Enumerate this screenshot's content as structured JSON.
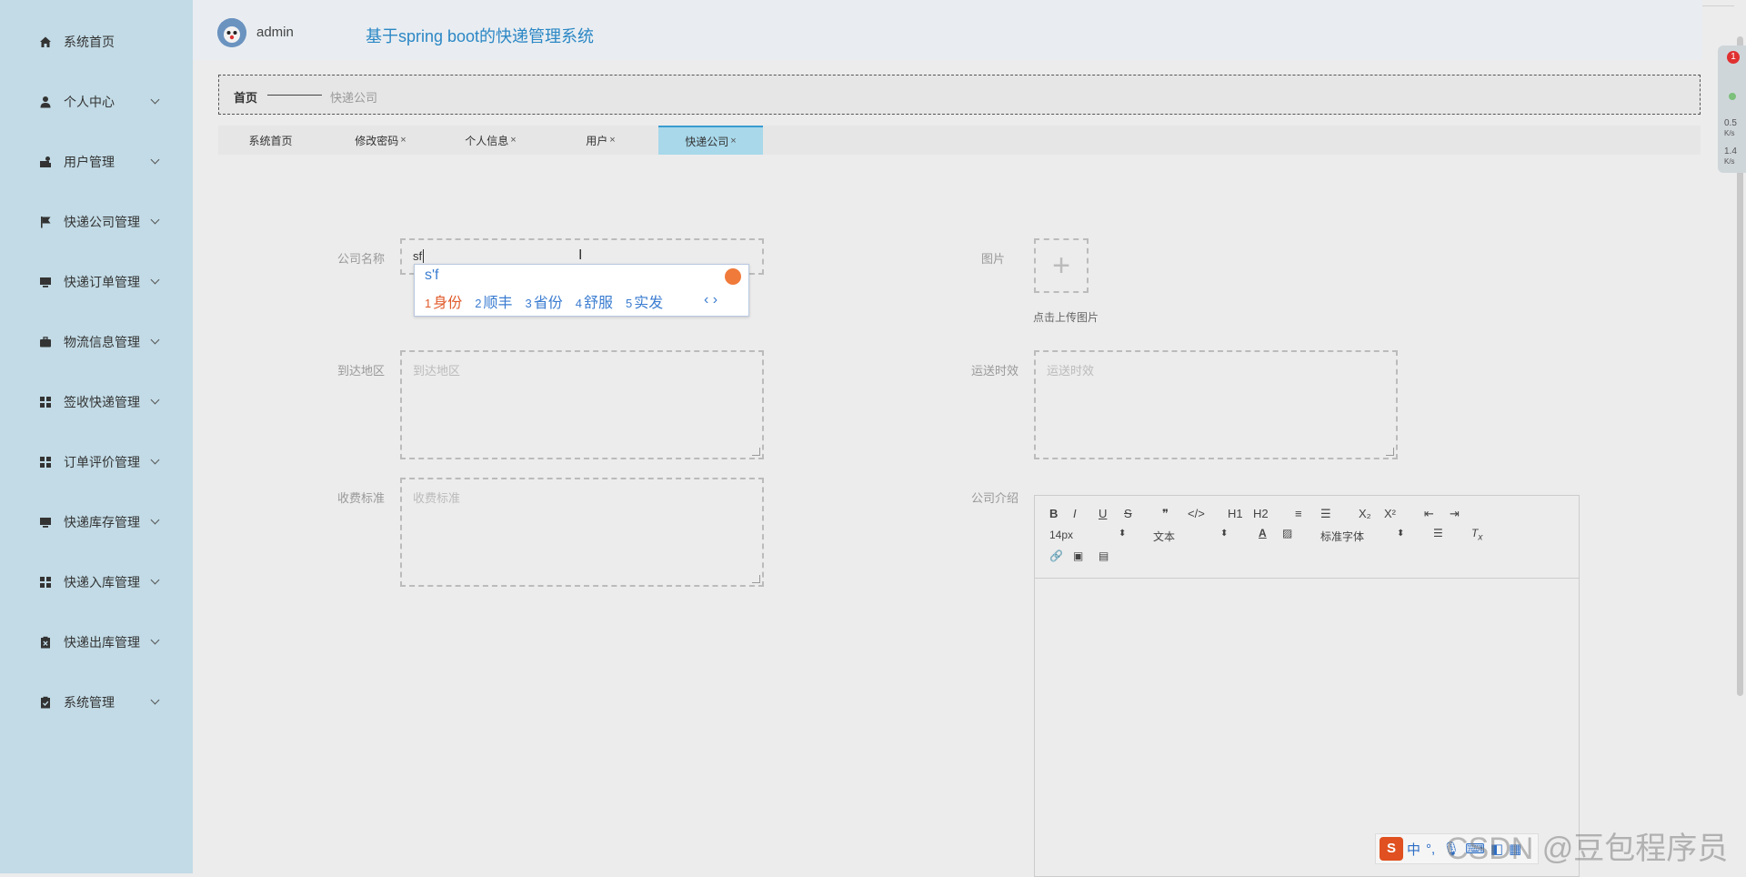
{
  "app": {
    "title": "基于spring boot的快递管理系统",
    "user": "admin"
  },
  "sidebar": {
    "items": [
      {
        "label": "系统首页",
        "icon": "home-icon",
        "has_submenu": false
      },
      {
        "label": "个人中心",
        "icon": "user-icon",
        "has_submenu": true
      },
      {
        "label": "用户管理",
        "icon": "user-manage-icon",
        "has_submenu": true
      },
      {
        "label": "快递公司管理",
        "icon": "flag-icon",
        "has_submenu": true
      },
      {
        "label": "快递订单管理",
        "icon": "monitor-icon",
        "has_submenu": true
      },
      {
        "label": "物流信息管理",
        "icon": "briefcase-icon",
        "has_submenu": true
      },
      {
        "label": "签收快递管理",
        "icon": "grid-icon",
        "has_submenu": true
      },
      {
        "label": "订单评价管理",
        "icon": "grid-icon",
        "has_submenu": true
      },
      {
        "label": "快递库存管理",
        "icon": "monitor-icon",
        "has_submenu": true
      },
      {
        "label": "快递入库管理",
        "icon": "grid-icon",
        "has_submenu": true
      },
      {
        "label": "快递出库管理",
        "icon": "clipboard-x-icon",
        "has_submenu": true
      },
      {
        "label": "系统管理",
        "icon": "clipboard-check-icon",
        "has_submenu": true
      }
    ]
  },
  "breadcrumb": {
    "home": "首页",
    "current": "快递公司"
  },
  "tabs": [
    {
      "label": "系统首页",
      "closable": false,
      "active": false
    },
    {
      "label": "修改密码",
      "closable": true,
      "active": false
    },
    {
      "label": "个人信息",
      "closable": true,
      "active": false
    },
    {
      "label": "用户",
      "closable": true,
      "active": false
    },
    {
      "label": "快递公司",
      "closable": true,
      "active": true
    }
  ],
  "tab_close": "×",
  "form": {
    "company_name": {
      "label": "公司名称",
      "value": "sf"
    },
    "image": {
      "label": "图片",
      "hint": "点击上传图片"
    },
    "region": {
      "label": "到达地区",
      "placeholder": "到达地区"
    },
    "timeliness": {
      "label": "运送时效",
      "placeholder": "运送时效"
    },
    "fee": {
      "label": "收费标准",
      "placeholder": "收费标准"
    },
    "intro": {
      "label": "公司介绍"
    }
  },
  "editor": {
    "font_size": "14px",
    "block_type": "文本",
    "font_family": "标准字体",
    "buttons": [
      "B",
      "I",
      "U",
      "S",
      "❞",
      "</>",
      "H1",
      "H2",
      "≡",
      "☰",
      "X₂",
      "X²",
      "⇤",
      "⇥"
    ]
  },
  "ime": {
    "composition": "s'f",
    "candidates": [
      {
        "n": "1",
        "text": "身份"
      },
      {
        "n": "2",
        "text": "顺丰"
      },
      {
        "n": "3",
        "text": "省份"
      },
      {
        "n": "4",
        "text": "舒服"
      },
      {
        "n": "5",
        "text": "实发"
      }
    ],
    "nav": "‹ ›"
  },
  "widget": {
    "badge": "1",
    "up": "0.5",
    "up_unit": "K/s",
    "down": "1.4",
    "down_unit": "K/s"
  },
  "ime_bar": {
    "lang": "中",
    "punct": "°,"
  },
  "watermark": "CSDN @豆包程序员"
}
